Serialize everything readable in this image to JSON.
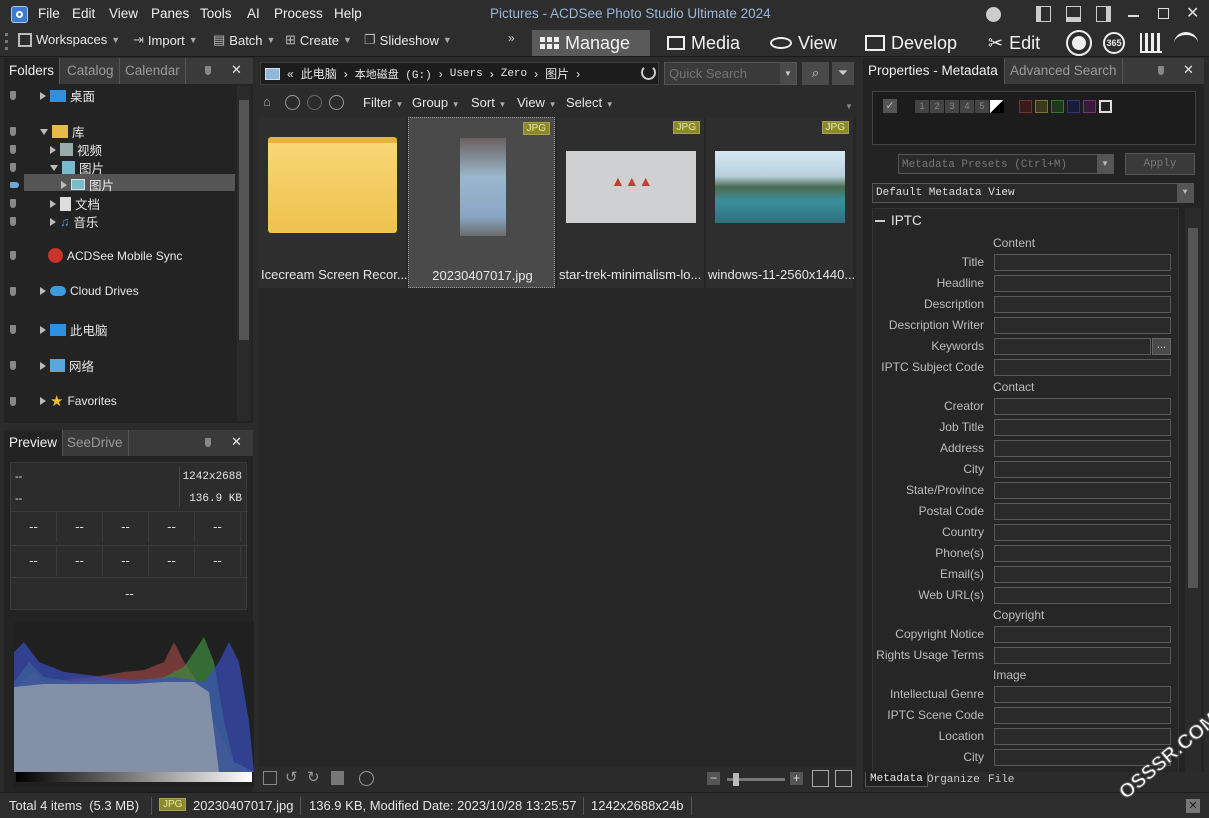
{
  "window": {
    "title": "Pictures - ACDSee Photo Studio Ultimate 2024"
  },
  "menu": [
    "File",
    "Edit",
    "View",
    "Panes",
    "Tools",
    "AI",
    "Process",
    "Help"
  ],
  "toolbar": {
    "workspaces": "Workspaces",
    "import": "Import",
    "batch": "Batch",
    "create": "Create",
    "slideshow": "Slideshow"
  },
  "modes": {
    "manage": "Manage",
    "media": "Media",
    "view": "View",
    "develop": "Develop",
    "edit": "Edit",
    "badge365": "365"
  },
  "left_tabs": {
    "folders": "Folders",
    "catalog": "Catalog",
    "calendar": "Calendar"
  },
  "tree": {
    "desktop": "桌面",
    "library": "库",
    "videos": "视频",
    "pictures": "图片",
    "pictures_sub": "图片",
    "documents": "文档",
    "music": "音乐",
    "mobile_sync": "ACDSee Mobile Sync",
    "cloud": "Cloud Drives",
    "pc": "此电脑",
    "network": "网络",
    "favorites": "Favorites"
  },
  "preview_tabs": {
    "preview": "Preview",
    "seedrive": "SeeDrive"
  },
  "preview": {
    "left1": "--",
    "left2": "--",
    "dims": "1242x2688",
    "size": "136.9 KB",
    "row1": [
      "--",
      "--",
      "--",
      "--",
      "--"
    ],
    "row2": [
      "--",
      "--",
      "--",
      "--",
      "--"
    ],
    "bottom": "--"
  },
  "breadcrumb": {
    "prefix": "«",
    "items": [
      "此电脑",
      "本地磁盘 (G:)",
      "Users",
      "Zero",
      "图片"
    ]
  },
  "search": {
    "placeholder": "Quick Search"
  },
  "filterbar": {
    "filter": "Filter",
    "group": "Group",
    "sort": "Sort",
    "view": "View",
    "select": "Select"
  },
  "files": [
    {
      "name": "Icecream Screen Recor...",
      "badge": ""
    },
    {
      "name": "20230407017.jpg",
      "badge": "JPG"
    },
    {
      "name": "star-trek-minimalism-lo...",
      "badge": "JPG"
    },
    {
      "name": "windows-11-2560x1440...",
      "badge": "JPG"
    }
  ],
  "right_tabs": {
    "properties": "Properties - Metadata",
    "advanced": "Advanced Search"
  },
  "rating": [
    "1",
    "2",
    "3",
    "4",
    "5"
  ],
  "metadata": {
    "presets": "Metadata Presets (Ctrl+M)",
    "apply": "Apply",
    "view": "Default Metadata View",
    "section": "IPTC"
  },
  "iptc": {
    "content_header": "Content",
    "content": [
      "Title",
      "Headline",
      "Description",
      "Description Writer",
      "Keywords",
      "IPTC Subject Code"
    ],
    "keywords_btn": "...",
    "contact_header": "Contact",
    "contact": [
      "Creator",
      "Job Title",
      "Address",
      "City",
      "State/Province",
      "Postal Code",
      "Country",
      "Phone(s)",
      "Email(s)",
      "Web URL(s)"
    ],
    "copyright_header": "Copyright",
    "copyright": [
      "Copyright Notice",
      "Rights Usage Terms"
    ],
    "image_header": "Image",
    "image": [
      "Intellectual Genre",
      "IPTC Scene Code",
      "Location",
      "City"
    ]
  },
  "bottom_tabs": {
    "metadata": "Metadata",
    "organize": "Organize",
    "file": "File"
  },
  "status": {
    "total": "Total 4 items  (5.3 MB)",
    "badge": "JPG",
    "file": "20230407017.jpg",
    "info": "136.9 KB, Modified Date: 2023/10/28 13:25:57",
    "dims": "1242x2688x24b"
  },
  "watermark": "OSSSR.COM",
  "colors": {
    "accent": "#4a7fc1",
    "selected": "#555555",
    "panel": "#232323",
    "badge": "#8a8a2a"
  }
}
